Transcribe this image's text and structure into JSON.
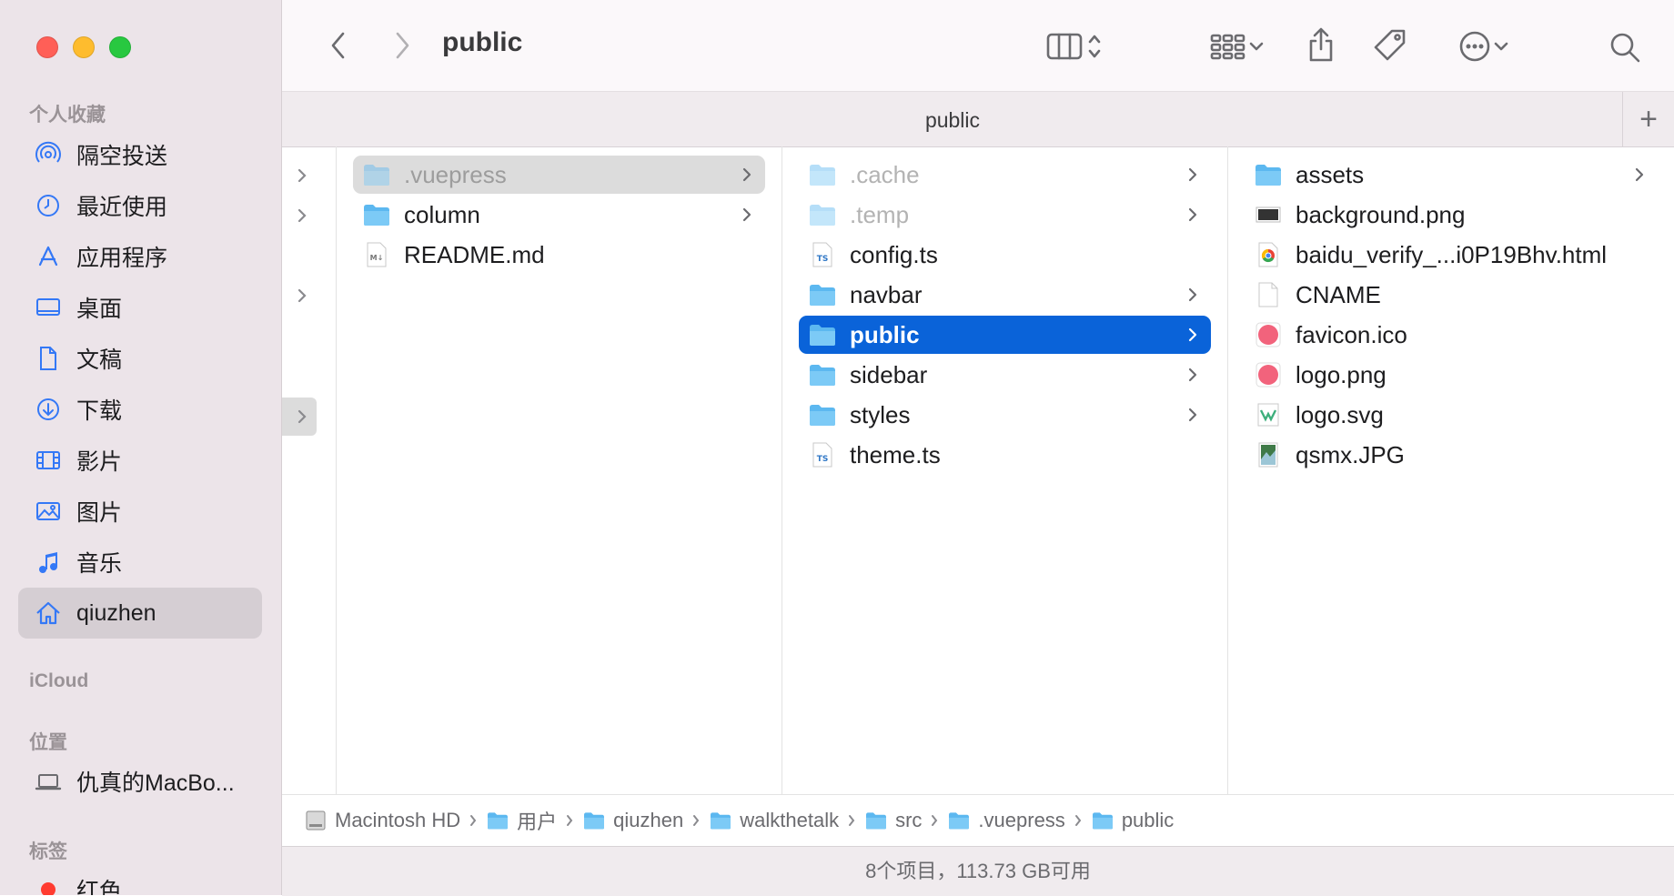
{
  "window": {
    "title": "public"
  },
  "sidebar": {
    "sections": {
      "favorites": "个人收藏",
      "icloud": "iCloud",
      "locations": "位置",
      "tags": "标签"
    },
    "favorites": [
      {
        "label": "隔空投送",
        "icon": "airdrop-icon"
      },
      {
        "label": "最近使用",
        "icon": "clock-icon"
      },
      {
        "label": "应用程序",
        "icon": "applications-icon"
      },
      {
        "label": "桌面",
        "icon": "desktop-icon"
      },
      {
        "label": "文稿",
        "icon": "document-icon"
      },
      {
        "label": "下载",
        "icon": "download-icon"
      },
      {
        "label": "影片",
        "icon": "film-icon"
      },
      {
        "label": "图片",
        "icon": "photo-icon"
      },
      {
        "label": "音乐",
        "icon": "music-icon"
      },
      {
        "label": "qiuzhen",
        "icon": "home-icon",
        "selected": true
      }
    ],
    "locations": [
      {
        "label": "仇真的MacBo...",
        "icon": "laptop-icon"
      }
    ],
    "tags": [
      {
        "label": "红色",
        "color": "#ff3b30"
      }
    ]
  },
  "toolbar": {
    "back": "chevron-left-icon",
    "forward": "chevron-right-icon",
    "view": "columns-view-icon",
    "group": "grid-group-icon",
    "share": "share-icon",
    "tag": "tag-icon",
    "more": "ellipsis-icon",
    "search": "search-icon"
  },
  "tab": {
    "title": "public",
    "add_label": "+"
  },
  "columns": {
    "col1": [
      {
        "name": ".vuepress",
        "kind": "folder",
        "dim": true,
        "selected": "gray",
        "chevron": true
      },
      {
        "name": "column",
        "kind": "folder",
        "chevron": true
      },
      {
        "name": "README.md",
        "kind": "md"
      }
    ],
    "col2": [
      {
        "name": ".cache",
        "kind": "folder",
        "dim": true,
        "chevron": true
      },
      {
        "name": ".temp",
        "kind": "folder",
        "dim": true,
        "chevron": true
      },
      {
        "name": "config.ts",
        "kind": "ts"
      },
      {
        "name": "navbar",
        "kind": "folder",
        "chevron": true
      },
      {
        "name": "public",
        "kind": "folder",
        "selected": "blue",
        "chevron": true
      },
      {
        "name": "sidebar",
        "kind": "folder",
        "chevron": true
      },
      {
        "name": "styles",
        "kind": "folder",
        "chevron": true
      },
      {
        "name": "theme.ts",
        "kind": "ts"
      }
    ],
    "col3": [
      {
        "name": "assets",
        "kind": "folder",
        "chevron": true
      },
      {
        "name": "background.png",
        "kind": "png-dark"
      },
      {
        "name": "baidu_verify_...i0P19Bhv.html",
        "kind": "html"
      },
      {
        "name": "CNAME",
        "kind": "file"
      },
      {
        "name": "favicon.ico",
        "kind": "ico"
      },
      {
        "name": "logo.png",
        "kind": "ico"
      },
      {
        "name": "logo.svg",
        "kind": "svg"
      },
      {
        "name": "qsmx.JPG",
        "kind": "jpg"
      }
    ]
  },
  "pathbar": [
    {
      "label": "Macintosh HD",
      "icon": "harddrive-icon"
    },
    {
      "label": "用户",
      "icon": "folder-icon"
    },
    {
      "label": "qiuzhen",
      "icon": "home-folder-icon"
    },
    {
      "label": "walkthetalk",
      "icon": "folder-icon"
    },
    {
      "label": "src",
      "icon": "folder-icon"
    },
    {
      "label": ".vuepress",
      "icon": "folder-icon"
    },
    {
      "label": "public",
      "icon": "folder-icon"
    }
  ],
  "status": {
    "text": "8个项目，113.73 GB可用"
  }
}
